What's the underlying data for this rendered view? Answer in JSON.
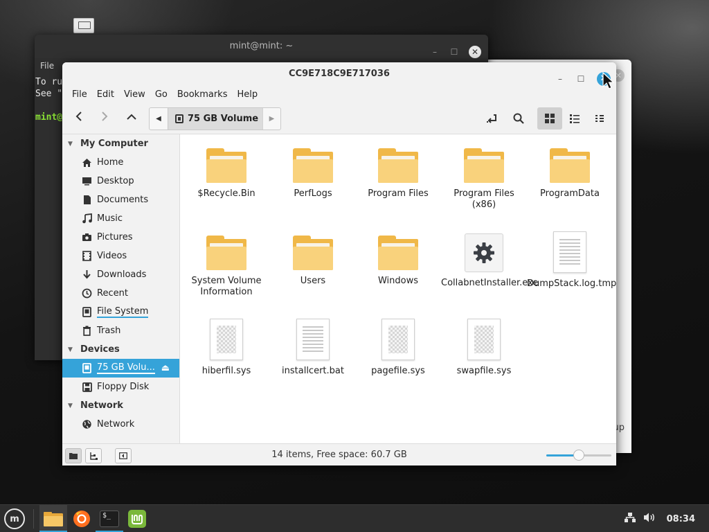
{
  "terminal": {
    "title": "mint@mint: ~",
    "menu_first": "File",
    "line1": "To ru",
    "line2": "See \"",
    "prompt": "mint@"
  },
  "side_window": {
    "tip_text": "up",
    "corner_text": "⁞"
  },
  "file_manager": {
    "title": "CC9E718C9E717036",
    "menu": [
      "File",
      "Edit",
      "View",
      "Go",
      "Bookmarks",
      "Help"
    ],
    "pathbar": {
      "current": "75 GB Volume"
    },
    "sidebar": {
      "sections": [
        {
          "title": "My Computer",
          "items": [
            {
              "label": "Home",
              "icon": "home-icon"
            },
            {
              "label": "Desktop",
              "icon": "desktop-icon"
            },
            {
              "label": "Documents",
              "icon": "documents-icon"
            },
            {
              "label": "Music",
              "icon": "music-icon"
            },
            {
              "label": "Pictures",
              "icon": "pictures-icon"
            },
            {
              "label": "Videos",
              "icon": "videos-icon"
            },
            {
              "label": "Downloads",
              "icon": "downloads-icon"
            },
            {
              "label": "Recent",
              "icon": "recent-icon"
            },
            {
              "label": "File System",
              "icon": "filesystem-icon"
            },
            {
              "label": "Trash",
              "icon": "trash-icon"
            }
          ]
        },
        {
          "title": "Devices",
          "items": [
            {
              "label": "75 GB Volu...",
              "icon": "drive-icon",
              "selected": true
            },
            {
              "label": "Floppy Disk",
              "icon": "floppy-icon"
            }
          ]
        },
        {
          "title": "Network",
          "items": [
            {
              "label": "Network",
              "icon": "network-icon"
            }
          ]
        }
      ]
    },
    "files": [
      {
        "name": "$Recycle.Bin",
        "type": "folder"
      },
      {
        "name": "PerfLogs",
        "type": "folder"
      },
      {
        "name": "Program Files",
        "type": "folder"
      },
      {
        "name": "Program Files (x86)",
        "type": "folder"
      },
      {
        "name": "ProgramData",
        "type": "folder"
      },
      {
        "name": "System Volume Information",
        "type": "folder"
      },
      {
        "name": "Users",
        "type": "folder"
      },
      {
        "name": "Windows",
        "type": "folder"
      },
      {
        "name": "CollabnetInstaller.exe",
        "type": "exe"
      },
      {
        "name": "DumpStack.log.tmp",
        "type": "text"
      },
      {
        "name": "hiberfil.sys",
        "type": "binary"
      },
      {
        "name": "installcert.bat",
        "type": "text"
      },
      {
        "name": "pagefile.sys",
        "type": "binary"
      },
      {
        "name": "swapfile.sys",
        "type": "binary"
      }
    ],
    "status": {
      "text": "14 items, Free space: 60.7 GB",
      "zoom_fraction": 0.5
    },
    "accent": "#35a3d9"
  },
  "taskbar": {
    "apps": [
      {
        "name": "files",
        "icon": "folder-icon",
        "running": true
      },
      {
        "name": "firefox",
        "icon": "firefox-icon",
        "running": false
      },
      {
        "name": "terminal",
        "icon": "terminal-icon",
        "running": true
      },
      {
        "name": "mintinstall",
        "icon": "mint-icon",
        "running": false
      }
    ],
    "menu_glyph": "m",
    "terminal_glyph": "$_",
    "clock": "08:34"
  }
}
